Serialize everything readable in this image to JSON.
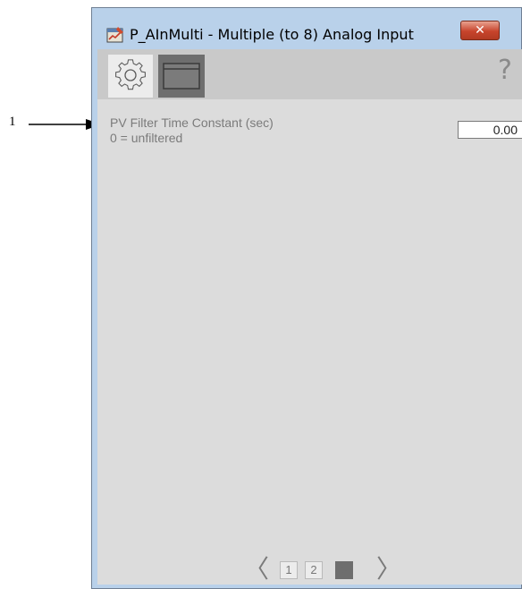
{
  "callout": {
    "number": "1"
  },
  "window": {
    "title": "P_AInMulti - Multiple (to 8) Analog Input",
    "close_label": "✕"
  },
  "toolbar": {
    "tabs": [
      {
        "name": "settings",
        "icon": "gear-icon",
        "active": true
      },
      {
        "name": "display",
        "icon": "window-icon",
        "active": false
      }
    ],
    "help_label": "?"
  },
  "parameter": {
    "label": "PV Filter Time Constant (sec)",
    "hint": "0 = unfiltered",
    "value": "0.00"
  },
  "pager": {
    "prev": "〈",
    "next": "〉",
    "pages": [
      "1",
      "2",
      "3"
    ],
    "current": "3"
  },
  "colors": {
    "window_frame": "#b9d1ea",
    "client": "#dcdcdc",
    "toolbar": "#c9c9c9",
    "close_button": "#c7442c",
    "active_page": "#6e6e6e"
  }
}
